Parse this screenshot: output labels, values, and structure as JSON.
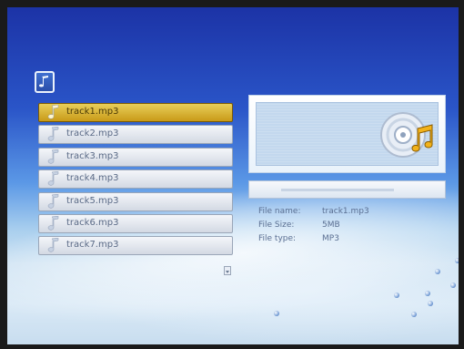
{
  "playlist": {
    "items": [
      {
        "label": "track1.mp3",
        "selected": true
      },
      {
        "label": "track2.mp3",
        "selected": false
      },
      {
        "label": "track3.mp3",
        "selected": false
      },
      {
        "label": "track4.mp3",
        "selected": false
      },
      {
        "label": "track5.mp3",
        "selected": false
      },
      {
        "label": "track6.mp3",
        "selected": false
      },
      {
        "label": "track7.mp3",
        "selected": false
      }
    ]
  },
  "player": {
    "progress": 0.0
  },
  "file_info": {
    "name_label": "File name:",
    "name_value": "track1.mp3",
    "size_label": "File Size:",
    "size_value": "5MB",
    "type_label": "File type:",
    "type_value": "MP3"
  },
  "colors": {
    "selected_highlight": "#c99a18",
    "progress_fill": "#2846b4",
    "background_top": "#1c33a6"
  },
  "icons": {
    "header": "music-note-icon",
    "list_item": "music-note-icon",
    "preview": "cd-disc-music-icon",
    "scroll": "scroll-down-arrow-icon"
  }
}
